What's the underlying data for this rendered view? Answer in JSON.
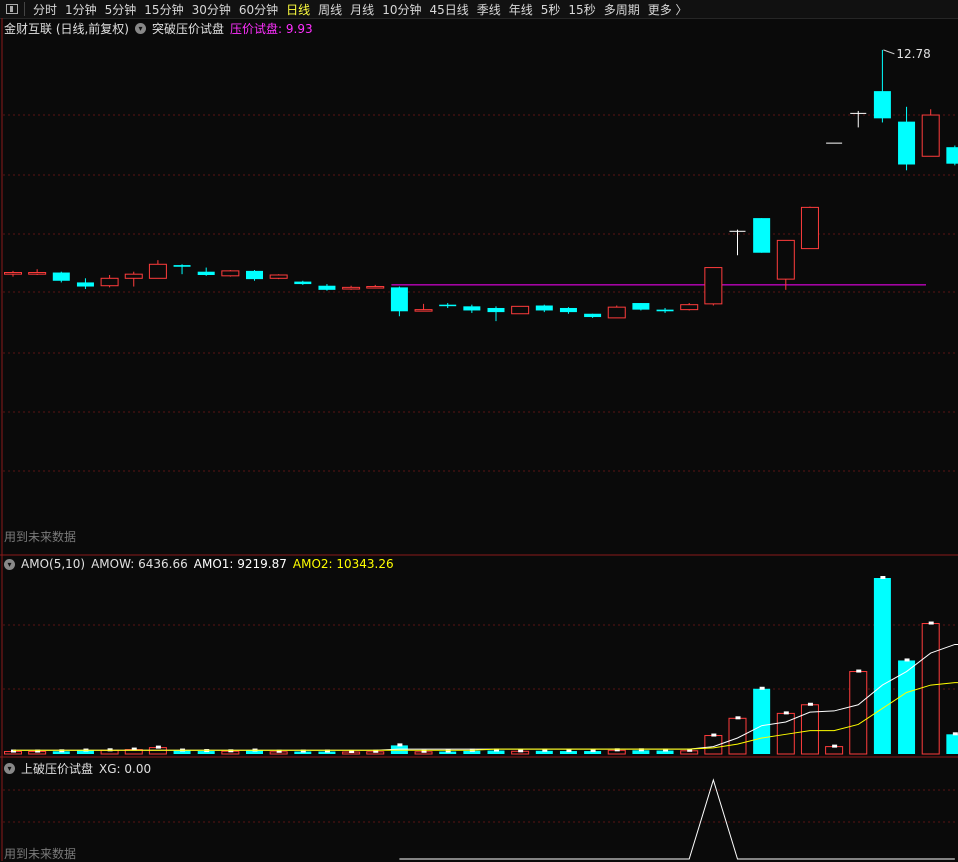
{
  "toolbar": {
    "tabs": [
      "分时",
      "1分钟",
      "5分钟",
      "15分钟",
      "30分钟",
      "60分钟",
      "日线",
      "周线",
      "月线",
      "10分钟",
      "45日线",
      "季线",
      "年线",
      "5秒",
      "15秒",
      "多周期",
      "更多 〉"
    ],
    "active_tab": "日线"
  },
  "main_panel": {
    "stock_title": "金财互联 (日线,前复权)",
    "indicator_name": "突破压价试盘",
    "indicator_value_label": "压价试盘: 9.93",
    "high_label": "12.78",
    "future_note": "用到未来数据"
  },
  "amo_panel": {
    "title": "AMO(5,10)",
    "amow_label": "AMOW: 6436.66",
    "amo1_label": "AMO1: 9219.87",
    "amo2_label": "AMO2: 10343.26"
  },
  "signal_panel": {
    "title": "上破压价试盘",
    "xg_label": "XG: 0.00",
    "future_note": "用到未来数据"
  },
  "colors": {
    "up": "#ff3c3c",
    "down": "#00ffff",
    "amo1": "#ffffff",
    "amo2": "#ffff00",
    "pressure": "#ff00ff",
    "active_tab": "#ffff40"
  },
  "chart_data": {
    "type": "candlestick",
    "price_ymin": 7.2,
    "price_ymax": 12.9,
    "pressure_price": 9.93,
    "candles": [
      {
        "o": 10.06,
        "c": 10.08,
        "h": 10.1,
        "l": 10.03,
        "vol": 0.2
      },
      {
        "o": 10.06,
        "c": 10.08,
        "h": 10.12,
        "l": 10.05,
        "vol": 0.2
      },
      {
        "o": 10.08,
        "c": 9.98,
        "h": 10.09,
        "l": 9.96,
        "vol": 0.22
      },
      {
        "o": 9.96,
        "c": 9.91,
        "h": 10.01,
        "l": 9.88,
        "vol": 0.28
      },
      {
        "o": 9.92,
        "c": 10.01,
        "h": 10.05,
        "l": 9.9,
        "vol": 0.3
      },
      {
        "o": 10.01,
        "c": 10.06,
        "h": 10.09,
        "l": 9.91,
        "vol": 0.36
      },
      {
        "o": 10.01,
        "c": 10.18,
        "h": 10.23,
        "l": 10.01,
        "vol": 0.52
      },
      {
        "o": 10.17,
        "c": 10.15,
        "h": 10.18,
        "l": 10.06,
        "vol": 0.28
      },
      {
        "o": 10.09,
        "c": 10.05,
        "h": 10.14,
        "l": 10.04,
        "vol": 0.24
      },
      {
        "o": 10.04,
        "c": 10.1,
        "h": 10.11,
        "l": 10.03,
        "vol": 0.22
      },
      {
        "o": 10.1,
        "c": 10.0,
        "h": 10.11,
        "l": 9.98,
        "vol": 0.28
      },
      {
        "o": 10.01,
        "c": 10.05,
        "h": 10.06,
        "l": 10.0,
        "vol": 0.18
      },
      {
        "o": 9.97,
        "c": 9.94,
        "h": 9.98,
        "l": 9.93,
        "vol": 0.2
      },
      {
        "o": 9.92,
        "c": 9.87,
        "h": 9.94,
        "l": 9.86,
        "vol": 0.2
      },
      {
        "o": 9.88,
        "c": 9.9,
        "h": 9.92,
        "l": 9.87,
        "vol": 0.16
      },
      {
        "o": 9.91,
        "c": 9.91,
        "h": 9.93,
        "l": 9.89,
        "vol": 0.18
      },
      {
        "o": 9.9,
        "c": 9.61,
        "h": 9.91,
        "l": 9.55,
        "vol": 0.7
      },
      {
        "o": 9.62,
        "c": 9.63,
        "h": 9.7,
        "l": 9.62,
        "vol": 0.18
      },
      {
        "o": 9.69,
        "c": 9.68,
        "h": 9.71,
        "l": 9.65,
        "vol": 0.2
      },
      {
        "o": 9.67,
        "c": 9.62,
        "h": 9.69,
        "l": 9.59,
        "vol": 0.26
      },
      {
        "o": 9.65,
        "c": 9.6,
        "h": 9.67,
        "l": 9.49,
        "vol": 0.28
      },
      {
        "o": 9.58,
        "c": 9.67,
        "h": 9.67,
        "l": 9.58,
        "vol": 0.22
      },
      {
        "o": 9.68,
        "c": 9.62,
        "h": 9.69,
        "l": 9.6,
        "vol": 0.26
      },
      {
        "o": 9.65,
        "c": 9.6,
        "h": 9.66,
        "l": 9.58,
        "vol": 0.24
      },
      {
        "o": 9.58,
        "c": 9.54,
        "h": 9.58,
        "l": 9.53,
        "vol": 0.24
      },
      {
        "o": 9.53,
        "c": 9.66,
        "h": 9.68,
        "l": 9.53,
        "vol": 0.3
      },
      {
        "o": 9.71,
        "c": 9.63,
        "h": 9.71,
        "l": 9.62,
        "vol": 0.3
      },
      {
        "o": 9.63,
        "c": 9.61,
        "h": 9.65,
        "l": 9.59,
        "vol": 0.28
      },
      {
        "o": 9.63,
        "c": 9.69,
        "h": 9.71,
        "l": 9.62,
        "vol": 0.26
      },
      {
        "o": 9.7,
        "c": 10.14,
        "h": 10.14,
        "l": 9.68,
        "vol": 1.5
      },
      {
        "o": 10.58,
        "c": 10.58,
        "h": 10.6,
        "l": 10.29,
        "vol": 2.9
      },
      {
        "o": 10.74,
        "c": 10.32,
        "h": 10.74,
        "l": 10.32,
        "vol": 5.3
      },
      {
        "o": 10.0,
        "c": 10.47,
        "h": 10.47,
        "l": 9.87,
        "vol": 3.3
      },
      {
        "o": 10.37,
        "c": 10.87,
        "h": 10.88,
        "l": 10.37,
        "vol": 4.0
      },
      {
        "o": 11.65,
        "c": 11.65,
        "h": 11.65,
        "l": 11.65,
        "vol": 0.6
      },
      {
        "o": 12.01,
        "c": 12.01,
        "h": 12.04,
        "l": 11.84,
        "vol": 6.7
      },
      {
        "o": 12.28,
        "c": 11.95,
        "h": 12.78,
        "l": 11.9,
        "vol": 14.3
      },
      {
        "o": 11.91,
        "c": 11.39,
        "h": 12.09,
        "l": 11.32,
        "vol": 7.6
      },
      {
        "o": 11.49,
        "c": 11.99,
        "h": 12.06,
        "l": 11.54,
        "vol": 10.6
      },
      {
        "o": 11.6,
        "c": 11.4,
        "h": 11.62,
        "l": 11.38,
        "vol": 1.6
      }
    ],
    "amo1": [
      0.3,
      0.3,
      0.3,
      0.3,
      0.3,
      0.3,
      0.3,
      0.3,
      0.3,
      0.3,
      0.3,
      0.3,
      0.3,
      0.3,
      0.3,
      0.3,
      0.4,
      0.4,
      0.4,
      0.4,
      0.4,
      0.4,
      0.4,
      0.4,
      0.4,
      0.4,
      0.4,
      0.4,
      0.4,
      0.6,
      1.3,
      2.3,
      2.6,
      3.4,
      3.5,
      4.0,
      5.6,
      6.7,
      8.2,
      8.9
    ],
    "amo2": [
      0.3,
      0.3,
      0.3,
      0.3,
      0.3,
      0.3,
      0.3,
      0.3,
      0.3,
      0.3,
      0.3,
      0.3,
      0.3,
      0.3,
      0.3,
      0.3,
      0.3,
      0.3,
      0.3,
      0.3,
      0.4,
      0.4,
      0.4,
      0.4,
      0.4,
      0.4,
      0.4,
      0.4,
      0.4,
      0.5,
      0.8,
      1.3,
      1.6,
      1.9,
      1.9,
      2.4,
      3.7,
      5.0,
      5.6,
      5.8
    ],
    "xg": [
      0,
      0,
      0,
      0,
      0,
      0,
      0,
      0,
      0,
      0,
      0,
      0,
      0,
      0,
      0,
      0,
      0,
      0,
      0,
      0,
      0,
      0,
      0,
      0,
      0,
      0,
      0,
      0,
      0,
      1,
      0,
      0,
      0,
      0,
      0,
      0,
      0,
      0,
      0,
      0
    ]
  }
}
